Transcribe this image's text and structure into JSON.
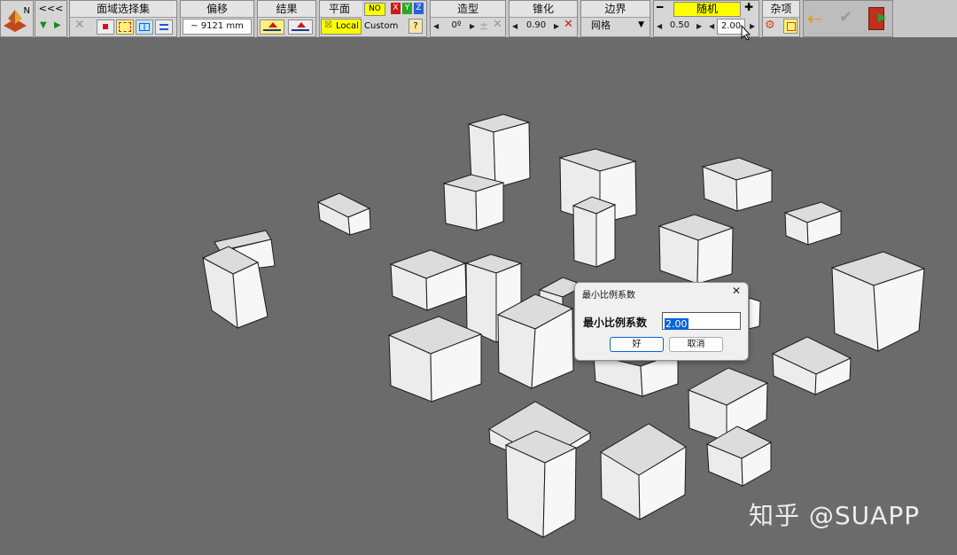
{
  "toolbar": {
    "logo_letter": "N",
    "nav": {
      "prev_label": "<<<"
    },
    "face_select": {
      "title": "面域选择集"
    },
    "offset": {
      "title": "偏移",
      "value": "~ 9121 mm"
    },
    "result": {
      "title": "结果"
    },
    "plane": {
      "title": "平面",
      "no_label": "NO",
      "x_label": "X",
      "y_label": "Y",
      "z_label": "Z",
      "local_label": "Local",
      "custom_label": "Custom",
      "help_label": "?"
    },
    "shape": {
      "title": "造型",
      "angle_value": "0º",
      "pm_label": "±"
    },
    "taper": {
      "title": "锥化",
      "value": "0.90"
    },
    "boundary": {
      "title": "边界",
      "value": "网格"
    },
    "random": {
      "title": "随机",
      "minus_label": "━",
      "plus_label": "✚",
      "min_value": "0.50",
      "max_value": "2.00"
    },
    "misc": {
      "title": "杂项"
    }
  },
  "dialog": {
    "title": "最小比例系数",
    "close_label": "✕",
    "field_label": "最小比例系数",
    "field_value": "2.00",
    "ok_label": "好",
    "cancel_label": "取消"
  },
  "watermark": "知乎 @SUAPP",
  "colors": {
    "background": "#6b6b6b",
    "toolbar": "#d6d6d6",
    "highlight_yellow": "#ffff00",
    "selection_blue": "#0a64d6"
  }
}
